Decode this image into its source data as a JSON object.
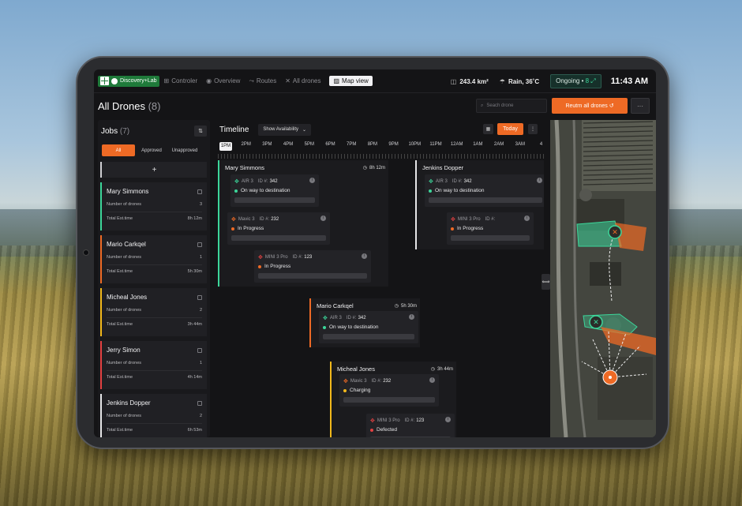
{
  "nav": {
    "brand": "Discovery+Lab",
    "items": [
      {
        "label": "Controler",
        "icon": "gamepad-icon",
        "glyph": "⊞"
      },
      {
        "label": "Overview",
        "icon": "eye-icon",
        "glyph": "◉"
      },
      {
        "label": "Routes",
        "icon": "route-icon",
        "glyph": "⤳"
      },
      {
        "label": "All drones",
        "icon": "drone-icon",
        "glyph": "✕"
      },
      {
        "label": "Map view",
        "icon": "map-icon",
        "glyph": "▨",
        "active": true
      }
    ]
  },
  "stats": {
    "area": "243.4 km²",
    "weather": "Rain, 36˚C",
    "ongoing_label": "Ongoing •",
    "ongoing_count": "8",
    "time": "11:43 AM"
  },
  "page": {
    "title": "All Drones",
    "count": "(8)",
    "search_placeholder": "Seach drone",
    "return_label": "Reutrn all drones ↺",
    "more_label": "···"
  },
  "jobs": {
    "title": "Jobs",
    "count": "(7)",
    "filters": [
      "All",
      "Approved",
      "Unapproved"
    ],
    "add_label": "+",
    "list": [
      {
        "name": "Mary Simmons",
        "drones_label": "Number of drones",
        "drones": "3",
        "time_label": "Total Est.time",
        "time": "8h 12m",
        "color": "#3cd69a"
      },
      {
        "name": "Mario Carkqel",
        "drones_label": "Number of drones",
        "drones": "1",
        "time_label": "Total Est.time",
        "time": "5h 30m",
        "color": "#ee6a25"
      },
      {
        "name": "Micheal Jones",
        "drones_label": "Number of drones",
        "drones": "2",
        "time_label": "Total Est.time",
        "time": "3h 44m",
        "color": "#f2b81b"
      },
      {
        "name": "Jerry Simon",
        "drones_label": "Number of drones",
        "drones": "1",
        "time_label": "Total Est.time",
        "time": "4h 14m",
        "color": "#e34141"
      },
      {
        "name": "Jenkins Dopper",
        "drones_label": "Number of drones",
        "drones": "2",
        "time_label": "Total Est.time",
        "time": "6h 53m",
        "color": "#e6e6e8"
      }
    ]
  },
  "timeline": {
    "title": "Timeline",
    "availability_label": "Show Availability",
    "today_label": "Today",
    "hours": [
      "1PM",
      "2PM",
      "3PM",
      "4PM",
      "5PM",
      "6PM",
      "7PM",
      "8PM",
      "9PM",
      "10PM",
      "11PM",
      "12AM",
      "1AM",
      "2AM",
      "3AM",
      "4"
    ],
    "blocks": [
      {
        "name": "Mary Simmons",
        "duration": "8h 12m",
        "color": "#3cd69a",
        "drones": [
          {
            "model": "AIR 3",
            "id_label": "ID #:",
            "id": "342",
            "status": "On way to destination",
            "status_color": "#3cd69a",
            "icon_color": "#3cd69a"
          },
          {
            "model": "Mavic 3",
            "id_label": "ID #:",
            "id": "232",
            "status": "In Progress",
            "status_color": "#ee6a25",
            "icon_color": "#ee6a25"
          },
          {
            "model": "MINI 3 Pro",
            "id_label": "ID #:",
            "id": "123",
            "status": "In Progress",
            "status_color": "#ee6a25",
            "icon_color": "#e34141"
          }
        ]
      },
      {
        "name": "Jenkins Dopper",
        "duration": "",
        "color": "#e6e6e8",
        "drones": [
          {
            "model": "AIR 3",
            "id_label": "ID #:",
            "id": "342",
            "status": "On way to destination",
            "status_color": "#3cd69a",
            "icon_color": "#3cd69a"
          },
          {
            "model": "MINI 3 Pro",
            "id_label": "ID #:",
            "id": "",
            "status": "In Progress",
            "status_color": "#ee6a25",
            "icon_color": "#e34141"
          }
        ]
      },
      {
        "name": "Mario Carkqel",
        "duration": "5h 30m",
        "color": "#ee6a25",
        "drones": [
          {
            "model": "AIR 3",
            "id_label": "ID #:",
            "id": "342",
            "status": "On way to destination",
            "status_color": "#3cd69a",
            "icon_color": "#3cd69a"
          }
        ]
      },
      {
        "name": "Micheal Jones",
        "duration": "3h 44m",
        "color": "#f2b81b",
        "drones": [
          {
            "model": "Mavic 3",
            "id_label": "ID #:",
            "id": "232",
            "status": "Charging",
            "status_color": "#f2b81b",
            "icon_color": "#ee6a25"
          },
          {
            "model": "MINI 3 Pro",
            "id_label": "ID #:",
            "id": "123",
            "status": "Defected",
            "status_color": "#e34141",
            "icon_color": "#e34141"
          }
        ]
      }
    ]
  },
  "colors": {
    "accent": "#ee6a25",
    "green": "#3cd69a",
    "yellow": "#f2b81b",
    "red": "#e34141"
  }
}
